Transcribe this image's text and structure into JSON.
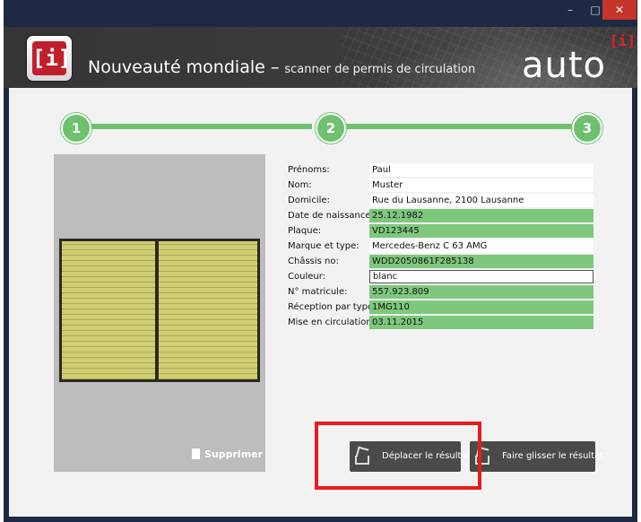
{
  "window": {
    "controls": {
      "minimize": "–",
      "maximize": "□",
      "close": "✕"
    }
  },
  "header": {
    "logo_glyph": "[i]",
    "title_main": "Nouveauté mondiale –",
    "title_sub": "scanner de permis de circulation",
    "brand": "auto",
    "brand_sup": "[i]"
  },
  "steps": [
    "1",
    "2",
    "3"
  ],
  "preview": {
    "delete_label": "Supprimer"
  },
  "fields": [
    {
      "label": "Prénoms:",
      "value": "Paul",
      "state": "plain"
    },
    {
      "label": "Nom:",
      "value": "Muster",
      "state": "plain"
    },
    {
      "label": "Domicile:",
      "value": "Rue du Lausanne, 2100 Lausanne",
      "state": "plain"
    },
    {
      "label": "Date de naissance:",
      "value": "25.12.1982",
      "state": "green"
    },
    {
      "label": "Plaque:",
      "value": "VD123445",
      "state": "green"
    },
    {
      "label": "Marque et type:",
      "value": "Mercedes-Benz C 63 AMG",
      "state": "plain"
    },
    {
      "label": "Châssis no:",
      "value": "WDD2050861F285138",
      "state": "green"
    },
    {
      "label": "Couleur:",
      "value": "blanc",
      "state": "edit"
    },
    {
      "label": "N° matricule:",
      "value": "557.923.809",
      "state": "green"
    },
    {
      "label": "Réception par type:",
      "value": "1MG110",
      "state": "green"
    },
    {
      "label": "Mise en circulation:",
      "value": "03.11.2015",
      "state": "green"
    }
  ],
  "actions": {
    "move_label": "Déplacer le résultat",
    "drag_label": "Faire glisser le résultat"
  },
  "colors": {
    "accent_green": "#6fc16f",
    "field_green": "#7dc87d",
    "highlight_red": "#ea1b1b",
    "header_dark": "#3a3a3a",
    "logo_red": "#c21f2d"
  }
}
